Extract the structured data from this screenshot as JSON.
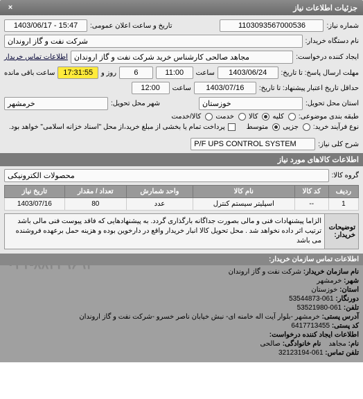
{
  "header": {
    "title": "جزئیات اطلاعات نیاز",
    "close": "×"
  },
  "form": {
    "request_no_label": "شماره نیاز:",
    "request_no": "1103093567000536",
    "public_datetime_label": "تاریخ و ساعت اعلان عمومی:",
    "public_datetime": "15:47 - 1403/06/17",
    "buyer_org_label": "نام دستگاه خریدار:",
    "buyer_org": "شرکت نفت و گاز اروندان",
    "creator_label": "ایجاد کننده درخواست:",
    "creator": "مجاهد صالحی کارشناس خرید شرکت نفت و گاز اروندان",
    "contact_link": "اطلاعات تماس خریدار",
    "deadline_label": "مهلت ارسال پاسخ: تا تاریخ:",
    "deadline_date": "1403/06/24",
    "time_label": "ساعت",
    "deadline_time": "11:00",
    "days_label": "روز و",
    "days": "6",
    "remaining_time": "17:31:55",
    "remaining_label": "ساعت باقی مانده",
    "validity_label": "حداقل تاریخ اعتبار پیشنهاد: تا تاریخ:",
    "validity_date": "1403/07/16",
    "validity_time": "12:00",
    "province_label": "استان محل تحویل:",
    "city_label": "شهر محل تحویل:",
    "province": "خوزستان",
    "city": "خرمشهر",
    "category_label": "طبقه بندی موضوعی:",
    "cat_all": "کلیه",
    "cat_goods": "کالا",
    "cat_service": "خدمت",
    "cat_goods_service": "کالا/خدمت",
    "process_label": "نوع فرآیند خرید:",
    "proc_low": "جزیی",
    "proc_mid": "متوسط",
    "proc_note": "پرداخت تمام یا بخشی از مبلغ خرید،از محل \"اسناد خزانه اسلامی\" خواهد بود.",
    "title_label": "شرح کلی نیاز:",
    "title_value": "P/F UPS CONTROL SYSTEM"
  },
  "section_titles": {
    "goods_info": "اطلاعات کالاهای مورد نیاز",
    "contact_info": "اطلاعات تماس سازمان خریدار:"
  },
  "goods_group_label": "گروه کالا:",
  "goods_group": "محصولات الکترونیکی",
  "table": {
    "headers": [
      "ردیف",
      "کد کالا",
      "نام کالا",
      "واحد شمارش",
      "تعداد / مقدار",
      "تاریخ نیاز"
    ],
    "rows": [
      {
        "idx": "1",
        "code": "--",
        "name": "اسپلیتر سیستم کنترل",
        "unit": "عدد",
        "qty": "80",
        "date": "1403/07/16"
      }
    ]
  },
  "notes": {
    "label": "توضیحات خریدار:",
    "text": "الزاما پیشنهادات فنی و مالی بصورت جداگانه بارگذاری گردد. به پیشنهادهایی که فاقد پیوست فنی مالی باشد ترتیب اثر داده نخواهد شد . محل تحویل کالا انبار خریدار واقع در دارخوین بوده و هزینه حمل برعهده فروشنده می باشد"
  },
  "footer": {
    "org_name_label": "نام سازمان خریدار:",
    "org_name": "شرکت نفت و گاز اروندان",
    "city_label": "شهر:",
    "city": "خرمشهر",
    "province_label": "استان:",
    "province": "خوزستان",
    "fax_label": "دورنگار:",
    "fax": "061-53544873",
    "phone_label": "تلفن:",
    "phone": "061-53521980",
    "address_label": "آدرس پستی:",
    "address": "خرمشهر -بلوار آیت اله خامنه ای- نبش خیابان ناصر خسرو -شرکت نفت و گاز اروندان",
    "postal_label": "کد پستی:",
    "postal": "6417713455",
    "creator_info_label": "اطلاعات ایجاد کننده درخواست:",
    "name_label": "نام:",
    "name": "مجاهد",
    "surname_label": "نام خانوادگی:",
    "surname": "صالحی",
    "contact_phone_label": "تلفن تماس:",
    "contact_phone": "061-32123194",
    "big_phone": "۰۲۱-۸۸۳۴۹۶۹۲"
  }
}
